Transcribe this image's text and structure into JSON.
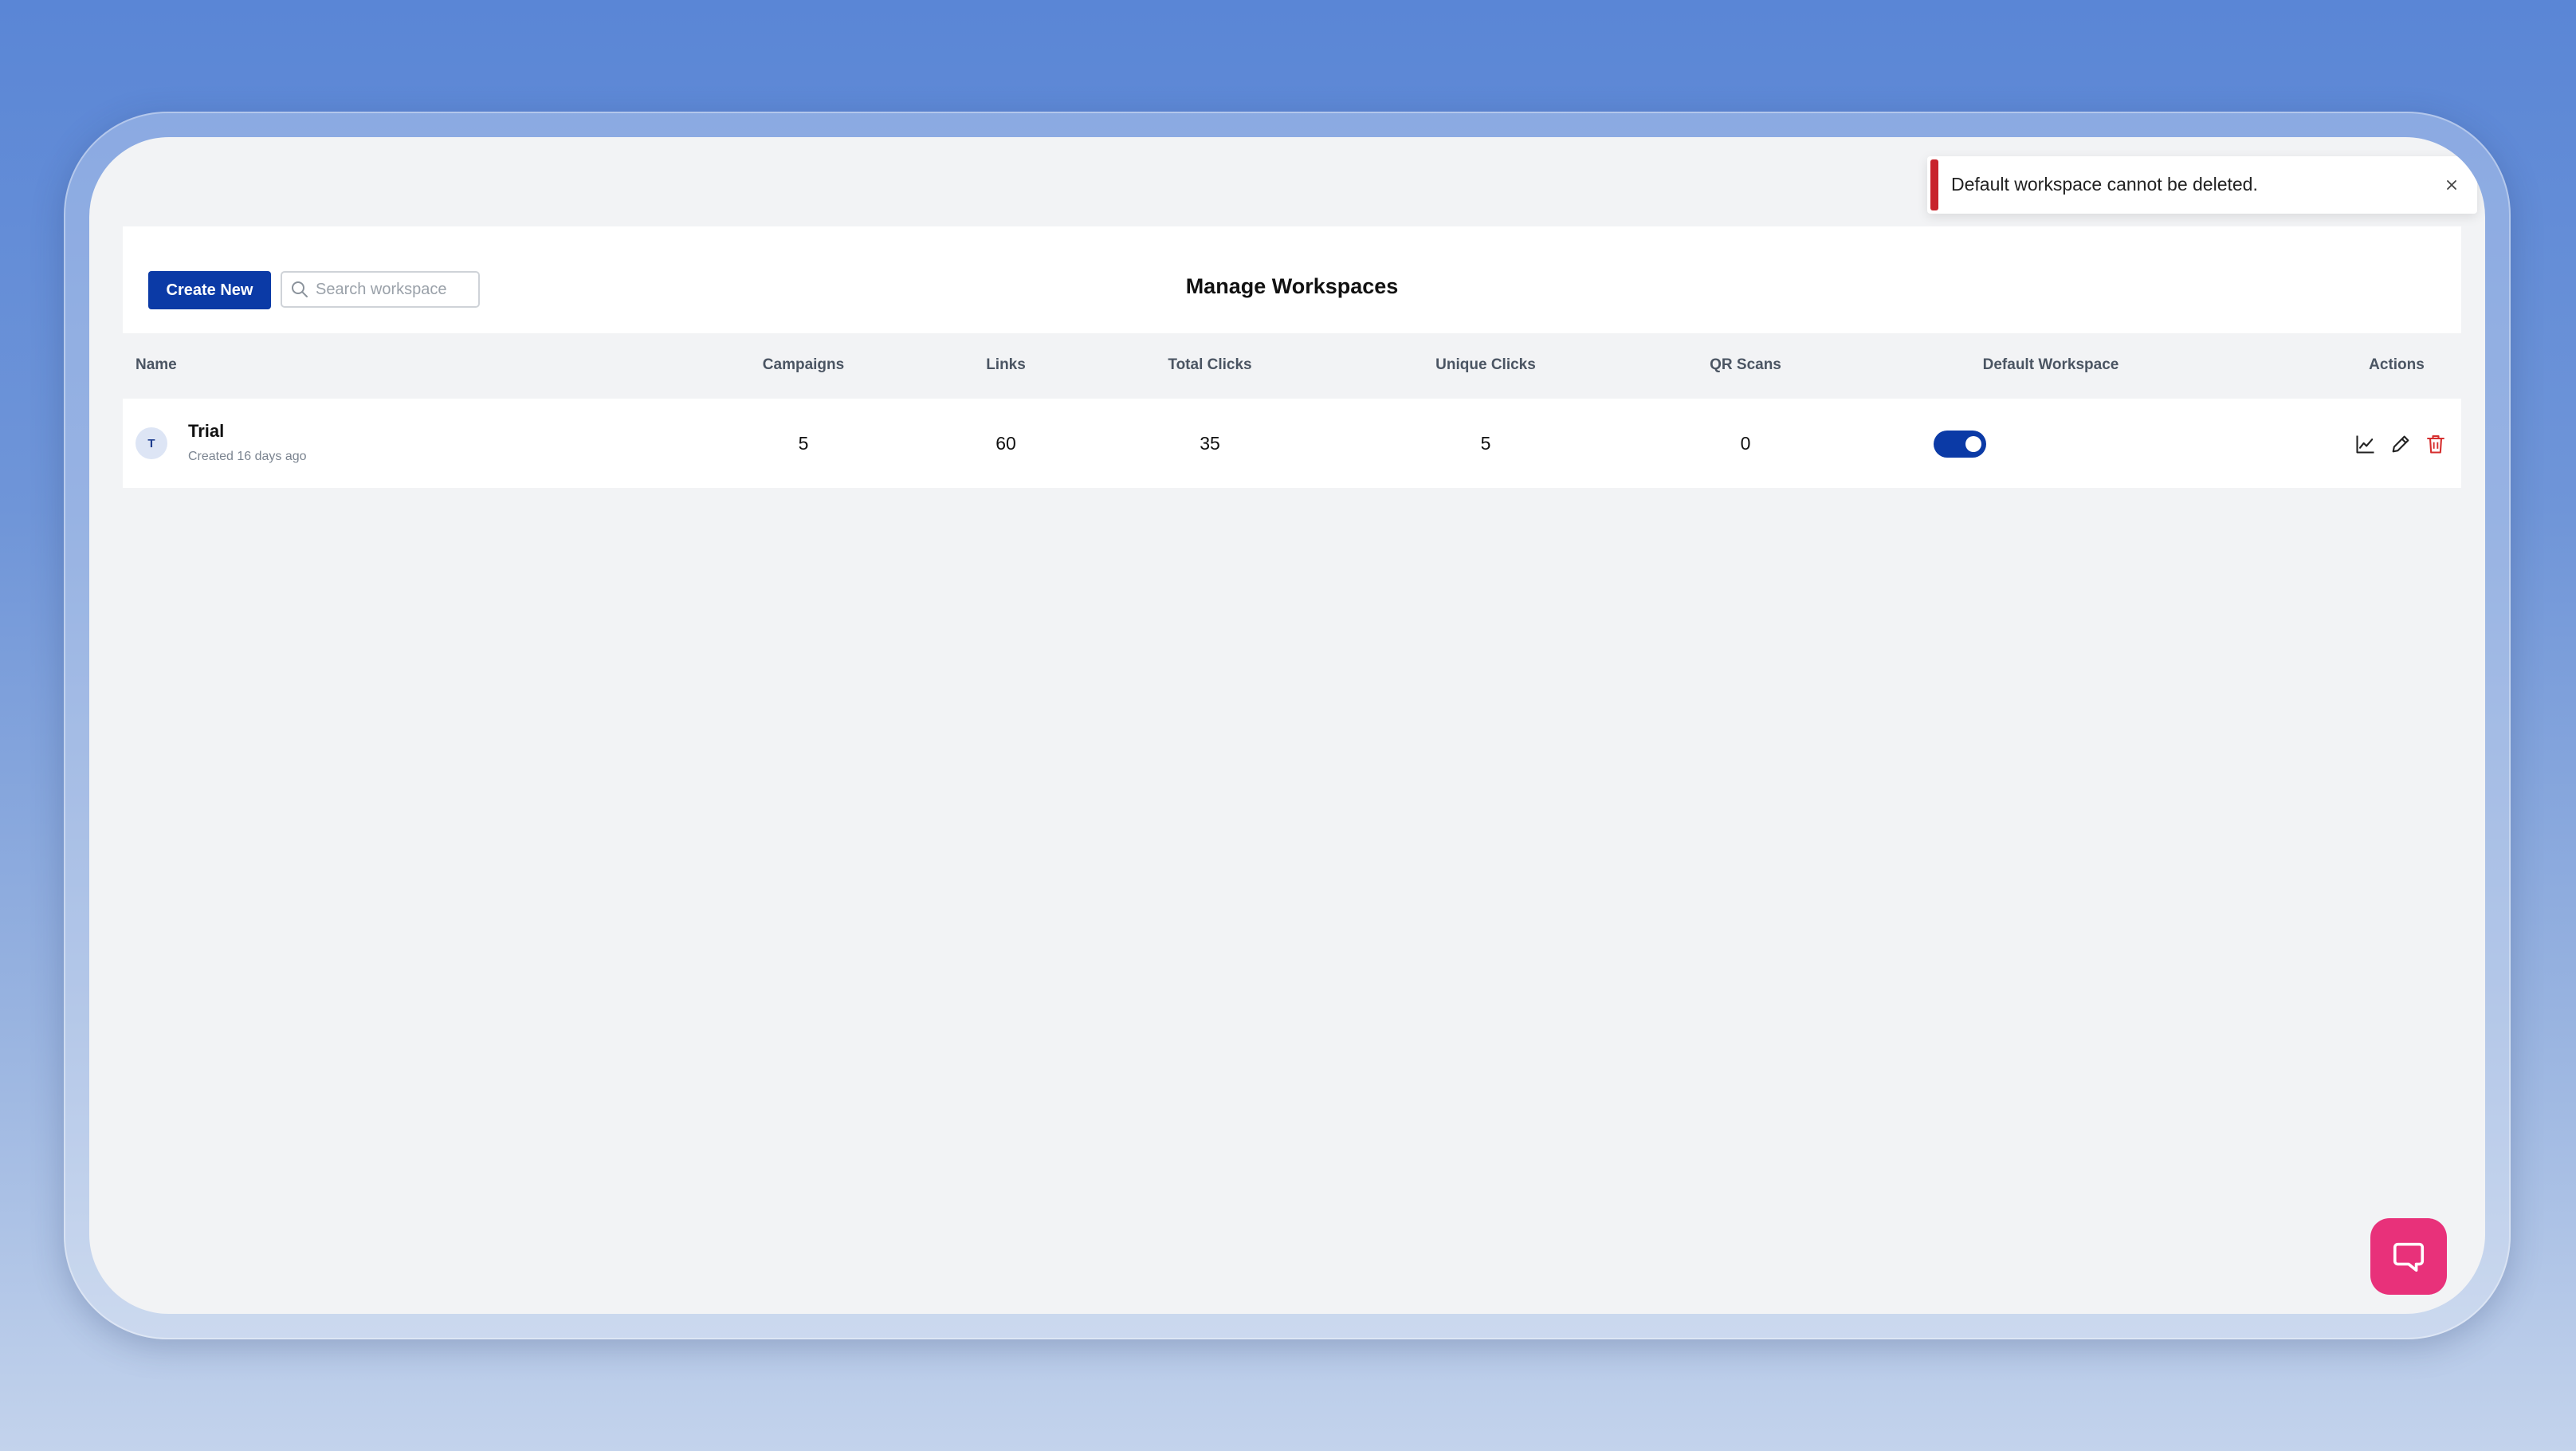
{
  "toolbar": {
    "create_label": "Create New",
    "search_placeholder": "Search workspace"
  },
  "page": {
    "title": "Manage Workspaces"
  },
  "table": {
    "headers": {
      "name": "Name",
      "campaigns": "Campaigns",
      "links": "Links",
      "total_clicks": "Total Clicks",
      "unique_clicks": "Unique Clicks",
      "qr_scans": "QR Scans",
      "default_workspace": "Default Workspace",
      "actions": "Actions"
    },
    "rows": [
      {
        "avatar_initial": "T",
        "name": "Trial",
        "created": "Created 16 days ago",
        "campaigns": "5",
        "links": "60",
        "total_clicks": "35",
        "unique_clicks": "5",
        "qr_scans": "0",
        "is_default": true
      }
    ]
  },
  "toast": {
    "message": "Default workspace cannot be deleted.",
    "type": "error",
    "accent_color": "#c8232c"
  },
  "icons": {
    "search": "search-icon",
    "analytics": "line-chart-icon",
    "edit": "pencil-icon",
    "delete": "trash-icon",
    "close": "close-icon",
    "chat": "chat-bubble-icon"
  },
  "colors": {
    "primary": "#0b3aa6",
    "danger": "#d62f2f",
    "chat_button": "#e8317a"
  }
}
